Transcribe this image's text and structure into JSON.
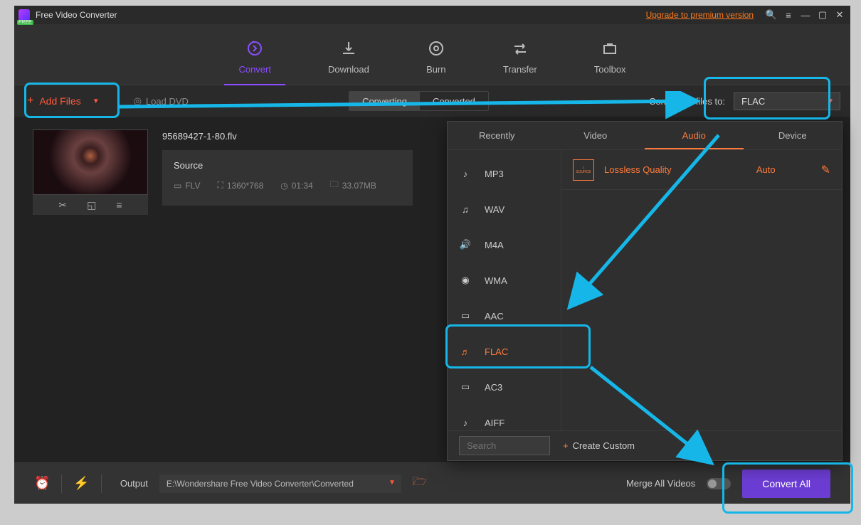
{
  "title": "Free Video Converter",
  "upgrade": "Upgrade to premium version",
  "nav": {
    "convert": "Convert",
    "download": "Download",
    "burn": "Burn",
    "transfer": "Transfer",
    "toolbox": "Toolbox"
  },
  "toolbar": {
    "add_files": "Add Files",
    "load_dvd": "Load DVD",
    "converting": "Converting",
    "converted": "Converted",
    "convert_all_to": "Convert all files to:",
    "format_selected": "FLAC"
  },
  "file": {
    "name": "95689427-1-80.flv",
    "source_label": "Source",
    "container": "FLV",
    "resolution": "1360*768",
    "duration": "01:34",
    "size": "33.07MB"
  },
  "popup": {
    "tabs": {
      "recently": "Recently",
      "video": "Video",
      "audio": "Audio",
      "device": "Device"
    },
    "formats": [
      "MP3",
      "WAV",
      "M4A",
      "WMA",
      "AAC",
      "FLAC",
      "AC3",
      "AIFF"
    ],
    "selected_format": "FLAC",
    "quality": {
      "label": "Lossless Quality",
      "auto": "Auto"
    },
    "search_placeholder": "Search",
    "create_custom": "Create Custom"
  },
  "bottom": {
    "output_label": "Output",
    "output_path": "E:\\Wondershare Free Video Converter\\Converted",
    "merge_label": "Merge All Videos",
    "convert_all": "Convert All"
  }
}
